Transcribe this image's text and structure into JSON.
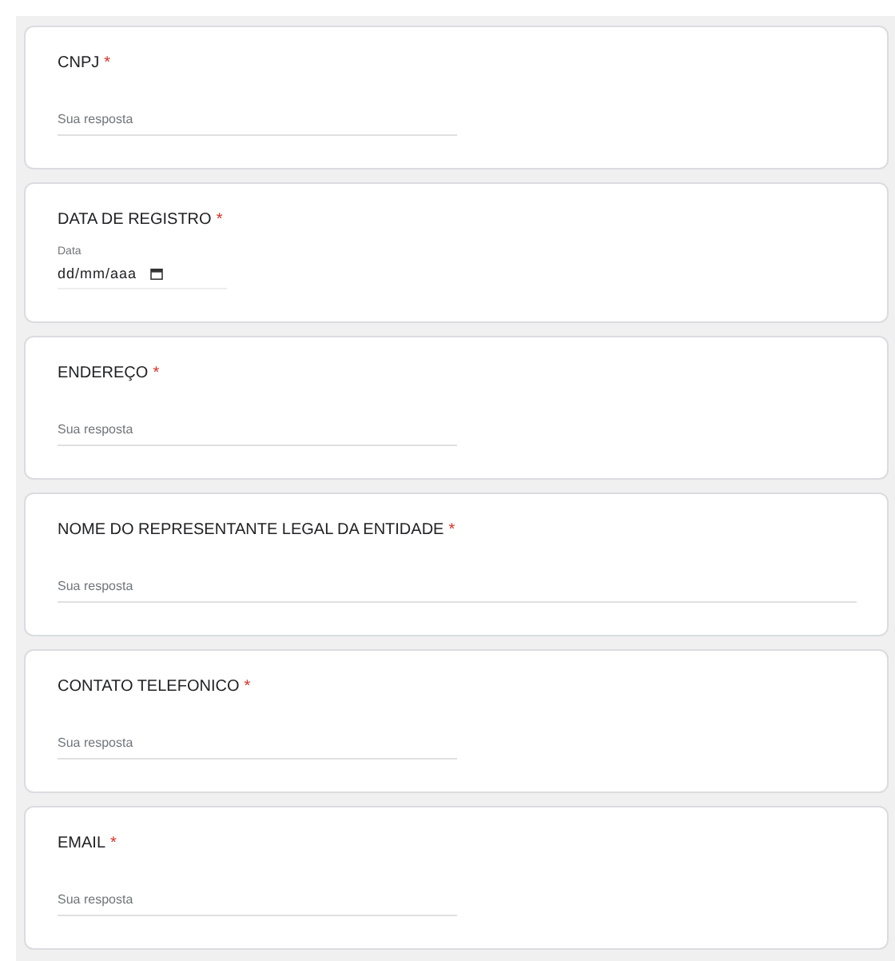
{
  "questions": [
    {
      "title": "CNPJ",
      "required_mark": "*",
      "kind": "text",
      "wide": false,
      "placeholder": "Sua resposta"
    },
    {
      "title": "DATA DE REGISTRO",
      "required_mark": "*",
      "kind": "date",
      "field_label": "Data",
      "value": "dd/mm/aaa"
    },
    {
      "title": "ENDEREÇO",
      "required_mark": "*",
      "kind": "text",
      "wide": false,
      "placeholder": "Sua resposta"
    },
    {
      "title": "NOME DO REPRESENTANTE LEGAL DA ENTIDADE",
      "required_mark": "*",
      "kind": "text",
      "wide": true,
      "placeholder": "Sua resposta"
    },
    {
      "title": "CONTATO TELEFONICO",
      "required_mark": "*",
      "kind": "text",
      "wide": false,
      "placeholder": "Sua resposta"
    },
    {
      "title": "EMAIL",
      "required_mark": "*",
      "kind": "text",
      "wide": false,
      "placeholder": "Sua resposta"
    }
  ]
}
